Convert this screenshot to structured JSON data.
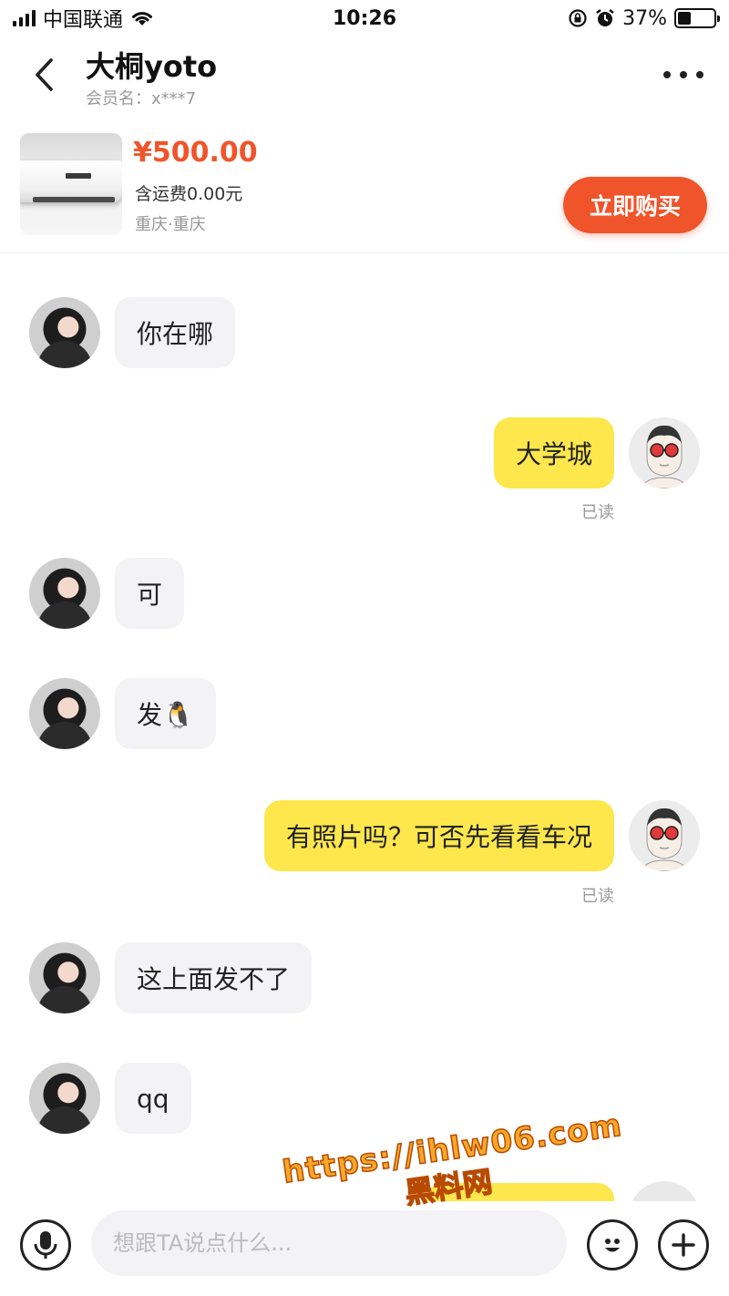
{
  "status_bar": {
    "carrier": "中国联通",
    "time": "10:26",
    "battery_text": "37%",
    "battery_level": 0.37
  },
  "header": {
    "title": "大桐yoto",
    "subtitle": "会员名：x***7"
  },
  "product": {
    "price": "¥500.00",
    "shipping": "含运费0.00元",
    "location": "重庆·重庆",
    "buy_label": "立即购买"
  },
  "messages": [
    {
      "side": "left",
      "text": "你在哪"
    },
    {
      "side": "right",
      "text": "大学城",
      "status": "已读"
    },
    {
      "side": "left",
      "text": "可"
    },
    {
      "side": "left",
      "text": "发🐧"
    },
    {
      "side": "right",
      "text": "有照片吗？可否先看看车况",
      "status": "已读"
    },
    {
      "side": "left",
      "text": "这上面发不了"
    },
    {
      "side": "left",
      "text": "qq"
    }
  ],
  "input": {
    "placeholder": "想跟TA说点什么..."
  },
  "watermark": {
    "url": "https://ihlw06.com",
    "name": "黑料网"
  },
  "colors": {
    "accent": "#f0542b",
    "my_bubble": "#fde74c",
    "their_bubble": "#f3f3f5"
  },
  "icons": {
    "back": "chevron-left-icon",
    "more": "more-dots-icon",
    "voice": "microphone-icon",
    "emoji": "emoji-icon",
    "plus": "plus-icon"
  }
}
